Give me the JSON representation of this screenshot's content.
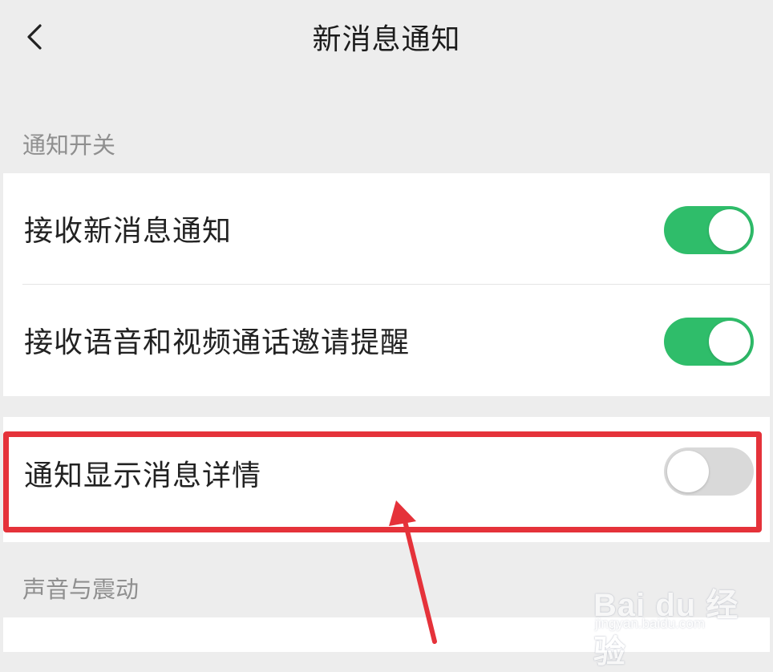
{
  "header": {
    "title": "新消息通知"
  },
  "sections": [
    {
      "label": "通知开关"
    },
    {
      "label": "声音与震动"
    }
  ],
  "settings": [
    {
      "label": "接收新消息通知",
      "enabled": true
    },
    {
      "label": "接收语音和视频通话邀请提醒",
      "enabled": true
    },
    {
      "label": "通知显示消息详情",
      "enabled": false
    }
  ],
  "colors": {
    "toggle_on": "#2fbd6a",
    "toggle_off": "#d9d9d9",
    "highlight": "#e5323a",
    "background": "#ededed"
  },
  "watermark": {
    "brand": "Bai du 经验",
    "url": "jingyan.baidu.com"
  }
}
